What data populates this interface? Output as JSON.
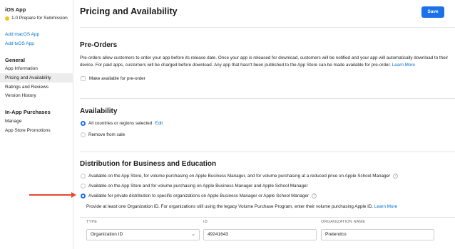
{
  "sidebar": {
    "app_title": "iOS App",
    "version": "1.0 Prepare for Submission",
    "add_macos": "Add macOS App",
    "add_tvos": "Add tvOS App",
    "general_heading": "General",
    "general_items": [
      "App Information",
      "Pricing and Availability",
      "Ratings and Reviews",
      "Version History"
    ],
    "iap_heading": "In-App Purchases",
    "iap_items": [
      "Manage",
      "App Store Promotions"
    ]
  },
  "header": {
    "title": "Pricing and Availability",
    "save_label": "Save"
  },
  "preorders": {
    "heading": "Pre-Orders",
    "description": "Pre-orders allow customers to order your app before its release date. Once your app is released for download, customers will be notified and your app will automatically download to their device. For paid apps, customers will be charged before download. Any app that hasn't been published to the App Store can be made available for pre-order.",
    "learn_more": "Learn More",
    "checkbox_label": "Make available for pre-order"
  },
  "availability": {
    "heading": "Availability",
    "option_all": "All countries or regions selected",
    "edit_label": "Edit",
    "option_remove": "Remove from sale"
  },
  "distribution": {
    "heading": "Distribution for Business and Education",
    "option_1": "Available on the App Store, for volume purchasing on Apple Business Manager, and for volume purchasing at a reduced price on Apple School Manager",
    "option_2": "Available on the App Store and for volume purchasing on Apple Business Manager and Apple School Manager",
    "option_3": "Available for private distribution to specific organizations on Apple Business Manager or Apple School Manager",
    "help_glyph": "?",
    "note": "Provide at least one Organization ID. For organizations still using the legacy Volume Purchase Program, enter their volume purchasing Apple ID.",
    "learn_more": "Learn More",
    "table": {
      "col_type": "TYPE",
      "col_id": "ID",
      "col_name": "ORGANIZATION NAME",
      "row": {
        "type": "Organization ID",
        "id": "49241643",
        "name": "Pretendco"
      }
    }
  },
  "colors": {
    "accent": "#1b72e8",
    "arrow": "#e8482f",
    "status_dot": "#f5c518",
    "link": "#0070c9"
  },
  "icons": [
    "status-dot-icon",
    "chevron-down-icon",
    "help-icon",
    "red-arrow-icon"
  ]
}
